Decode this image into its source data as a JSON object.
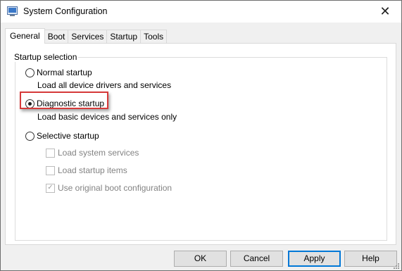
{
  "window": {
    "title": "System Configuration",
    "close_glyph": "✕"
  },
  "tabs": [
    {
      "label": "General",
      "active": true
    },
    {
      "label": "Boot",
      "active": false
    },
    {
      "label": "Services",
      "active": false
    },
    {
      "label": "Startup",
      "active": false
    },
    {
      "label": "Tools",
      "active": false
    }
  ],
  "startup_selection": {
    "group_title": "Startup selection",
    "normal": {
      "label": "Normal startup",
      "description": "Load all device drivers and services",
      "selected": false
    },
    "diagnostic": {
      "label": "Diagnostic startup",
      "description": "Load basic devices and services only",
      "selected": true
    },
    "selective": {
      "label": "Selective startup",
      "selected": false,
      "options": [
        {
          "label": "Load system services",
          "checked": false
        },
        {
          "label": "Load startup items",
          "checked": false
        },
        {
          "label": "Use original boot configuration",
          "checked": true
        }
      ]
    }
  },
  "buttons": {
    "ok": "OK",
    "cancel": "Cancel",
    "apply": "Apply",
    "help": "Help"
  },
  "colors": {
    "highlight": "#d63a3a",
    "focus": "#0078d7"
  },
  "icons": {
    "app": "msconfig-icon",
    "close": "close-icon",
    "grip": "resize-grip-icon"
  }
}
